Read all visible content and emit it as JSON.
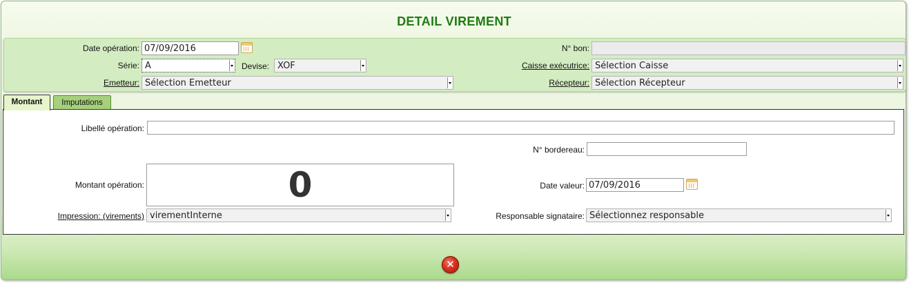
{
  "dialog": {
    "title": "DETAIL VIREMENT"
  },
  "header": {
    "date_operation": {
      "label": "Date opération:",
      "value": "07/09/2016"
    },
    "serie": {
      "label": "Série:",
      "value": "A"
    },
    "devise": {
      "label": "Devise:",
      "value": "XOF"
    },
    "emetteur": {
      "label": "Emetteur:",
      "value": "Sélection Emetteur"
    },
    "num_bon": {
      "label": "N° bon:",
      "value": ""
    },
    "caisse_executrice": {
      "label": "Caisse exécutrice:",
      "value": "Sélection Caisse"
    },
    "recepteur": {
      "label": "Récepteur:",
      "value": "Sélection Récepteur"
    }
  },
  "tabs": [
    {
      "label": "Montant",
      "active": true
    },
    {
      "label": "Imputations",
      "active": false
    }
  ],
  "montant_tab": {
    "libelle_operation": {
      "label": "Libellé opération:",
      "value": ""
    },
    "num_bordereau": {
      "label": "N° bordereau:",
      "value": ""
    },
    "montant_operation": {
      "label": "Montant opération:",
      "value": "0"
    },
    "date_valeur": {
      "label": "Date valeur:",
      "value": "07/09/2016"
    },
    "impression": {
      "label": "Impression: (virements)",
      "value": "virementInterne"
    },
    "responsable_signataire": {
      "label": "Responsable signataire:",
      "value": "Sélectionnez responsable"
    }
  },
  "footer": {
    "close_symbol": "✕"
  },
  "colors": {
    "title": "#1f7d12",
    "header_panel": "#d4ecc2",
    "tab_active": "#e6f5cb",
    "tab_inactive": "#a6d17c",
    "close_button": "#d8321e"
  },
  "icons": [
    "calendar-icon",
    "dropdown-arrow-icon",
    "close-icon"
  ]
}
